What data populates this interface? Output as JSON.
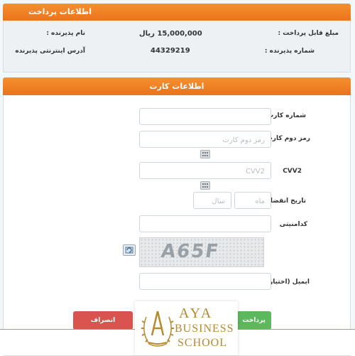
{
  "payment_info": {
    "header": "اطلاعات پرداخت",
    "amount_label": "مبلغ قابل پرداخت :",
    "amount_value": "15,000,000 ریال",
    "merchant_name_label": "نام پذیرنده :",
    "merchant_number_label": "شماره پذیرنده :",
    "merchant_number_value": "44329219",
    "merchant_website_label": "آدرس اینترنتی پذیرنده"
  },
  "card_info": {
    "header": "اطلاعات کارت",
    "card_number_label": "شماره کارت",
    "card_number_value": "",
    "second_password_label": "رمز دوم کارت",
    "second_password_placeholder": "رمز دوم کارت",
    "cvv2_label": "CVV2",
    "cvv2_placeholder": "CVV2",
    "expiry_label": "تاریخ انقضا",
    "expiry_month_placeholder": "ماه",
    "expiry_year_placeholder": "سال",
    "captcha_label": "کدامنیتی",
    "captcha_text": "A65F",
    "email_label": "ایمیل (اختیاری)"
  },
  "actions": {
    "cancel_label": "انصراف",
    "pay_label": "پرداخت"
  },
  "watermark": {
    "line1": "AYA",
    "line2": "BUSINESS",
    "line3": "SCHOOL"
  },
  "colors": {
    "header_orange": "#f07f24",
    "cancel_red": "#d9534f",
    "pay_green": "#5cb85c",
    "brand_gold": "#b8892e"
  }
}
